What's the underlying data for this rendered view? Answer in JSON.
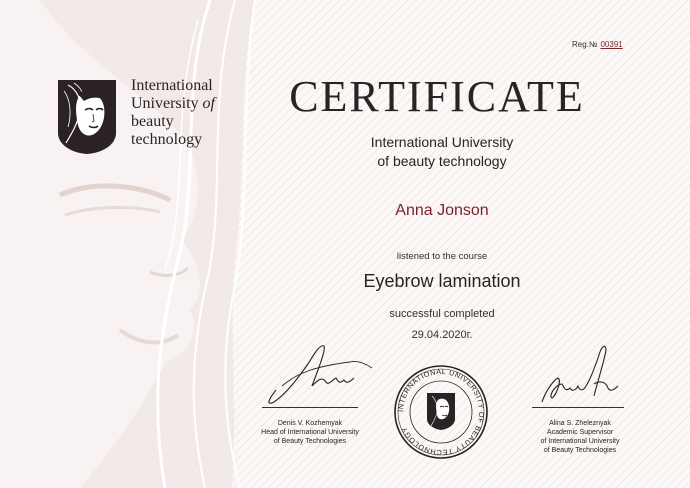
{
  "registration": {
    "label": "Reg.№",
    "number": "00391"
  },
  "logo": {
    "icon": "woman-face-logo-icon",
    "line1": "International",
    "line2a": "University",
    "line2b": "of",
    "line3": "beauty",
    "line4": "technology"
  },
  "title": "CERTIFICATE",
  "issuer": {
    "line1": "International University",
    "line2": "of beauty technology"
  },
  "recipient": "Anna Jonson",
  "listened": "listened to the course",
  "course": "Eyebrow lamination",
  "status": "successful completed",
  "date": "29.04.2020г.",
  "seal": {
    "text": "INTERNATIONAL UNIVERSITY OF BEAUTY TECHNOLOGY",
    "icon": "woman-face-seal-icon"
  },
  "signatory_left": {
    "name": "Denis V. Kozhemyak",
    "title1": "Head of International University",
    "title2": "of Beauty Technologies"
  },
  "signatory_right": {
    "name": "Alina S. Zheleznyak",
    "title1": "Academic Supervisor",
    "title2": "of International University",
    "title3": "of Beauty Technologies"
  },
  "colors": {
    "ink": "#2b2224",
    "recipient": "#7a1f2a",
    "pattern": "#ceaca6",
    "background": "#fbf8f7"
  }
}
